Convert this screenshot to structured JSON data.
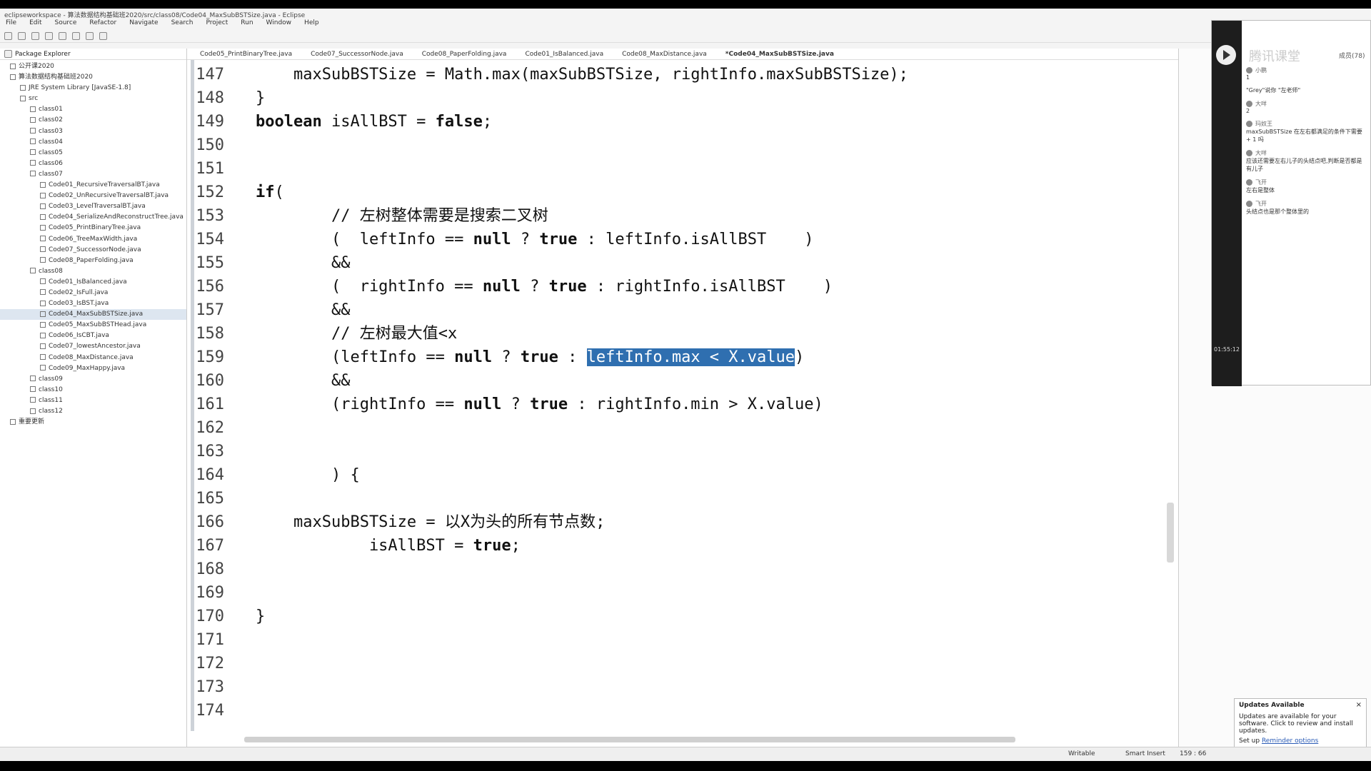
{
  "window": {
    "title": "eclipseworkspace - 算法数据结构基础班2020/src/class08/Code04_MaxSubBSTSize.java - Eclipse"
  },
  "menu": [
    "File",
    "Edit",
    "Source",
    "Refactor",
    "Navigate",
    "Search",
    "Project",
    "Run",
    "Window",
    "Help"
  ],
  "package_explorer": {
    "title": "Package Explorer",
    "items": [
      "公开课2020",
      "算法数据结构基础班2020",
      "JRE System Library [JavaSE-1.8]",
      "src",
      "class01",
      "class02",
      "class03",
      "class04",
      "class05",
      "class06",
      "class07",
      "Code01_RecursiveTraversalBT.java",
      "Code02_UnRecursiveTraversalBT.java",
      "Code03_LevelTraversalBT.java",
      "Code04_SerializeAndReconstructTree.java",
      "Code05_PrintBinaryTree.java",
      "Code06_TreeMaxWidth.java",
      "Code07_SuccessorNode.java",
      "Code08_PaperFolding.java",
      "class08",
      "Code01_IsBalanced.java",
      "Code02_IsFull.java",
      "Code03_IsBST.java",
      "Code04_MaxSubBSTSize.java",
      "Code05_MaxSubBSTHead.java",
      "Code06_IsCBT.java",
      "Code07_lowestAncestor.java",
      "Code08_MaxDistance.java",
      "Code09_MaxHappy.java",
      "class09",
      "class10",
      "class11",
      "class12",
      "重要更新"
    ],
    "selected": "Code04_MaxSubBSTSize.java"
  },
  "tabs": [
    "Code05_PrintBinaryTree.java",
    "Code07_SuccessorNode.java",
    "Code08_PaperFolding.java",
    "Code01_IsBalanced.java",
    "Code08_MaxDistance.java",
    "*Code04_MaxSubBSTSize.java"
  ],
  "code": [
    {
      "n": "147",
      "t": "    maxSubBSTSize = Math.max(maxSubBSTSize, rightInfo.maxSubBSTSize);"
    },
    {
      "n": "148",
      "t": "}"
    },
    {
      "n": "149",
      "t": "boolean isAllBST = false;"
    },
    {
      "n": "150",
      "t": ""
    },
    {
      "n": "151",
      "t": ""
    },
    {
      "n": "152",
      "t": "if("
    },
    {
      "n": "153",
      "t": "        // 左树整体需要是搜索二叉树"
    },
    {
      "n": "154",
      "t": "        (  leftInfo == null ? true : leftInfo.isAllBST    )"
    },
    {
      "n": "155",
      "t": "        &&"
    },
    {
      "n": "156",
      "t": "        (  rightInfo == null ? true : rightInfo.isAllBST    )"
    },
    {
      "n": "157",
      "t": "        &&"
    },
    {
      "n": "158",
      "t": "        // 左树最大值<x"
    },
    {
      "n": "159",
      "pre": "        (leftInfo == null ? true : ",
      "sel": "leftInfo.max < X.value",
      "post": ")"
    },
    {
      "n": "160",
      "t": "        &&"
    },
    {
      "n": "161",
      "t": "        (rightInfo == null ? true : rightInfo.min > X.value)"
    },
    {
      "n": "162",
      "t": ""
    },
    {
      "n": "163",
      "t": ""
    },
    {
      "n": "164",
      "t": "        ) {"
    },
    {
      "n": "165",
      "t": ""
    },
    {
      "n": "166",
      "t": "    maxSubBSTSize = 以X为头的所有节点数;"
    },
    {
      "n": "167",
      "t": "            isAllBST = true;"
    },
    {
      "n": "168",
      "t": ""
    },
    {
      "n": "169",
      "t": ""
    },
    {
      "n": "170",
      "t": "}"
    },
    {
      "n": "171",
      "t": ""
    },
    {
      "n": "172",
      "t": ""
    },
    {
      "n": "173",
      "t": ""
    },
    {
      "n": "174",
      "t": ""
    }
  ],
  "video": {
    "title": "腾讯课堂",
    "count": "成员(78)",
    "time": "01:55:12",
    "chat": [
      {
        "name": "小鹏",
        "text": "1"
      },
      {
        "name": "",
        "text": "\"Grey\"说你 \"左老师\""
      },
      {
        "name": "大咩",
        "text": "2"
      },
      {
        "name": "玛奴王",
        "text": "maxSubBSTSize 在左右都满足的条件下需要 + 1 吗"
      },
      {
        "name": "大咩",
        "text": "应该还需要左右儿子的头结点吧,判断是否都是有儿子"
      },
      {
        "name": "飞开",
        "text": "左右是整体"
      },
      {
        "name": "飞开",
        "text": "头结点也是那个整体里的"
      }
    ]
  },
  "popup": {
    "title": "Updates Available",
    "body": "Updates are available for your software. Click to review and install updates.",
    "setup": "Set up",
    "link": "Reminder options",
    "close": "×"
  },
  "status": {
    "writable": "Writable",
    "insert": "Smart Insert",
    "position": "159 : 66"
  }
}
